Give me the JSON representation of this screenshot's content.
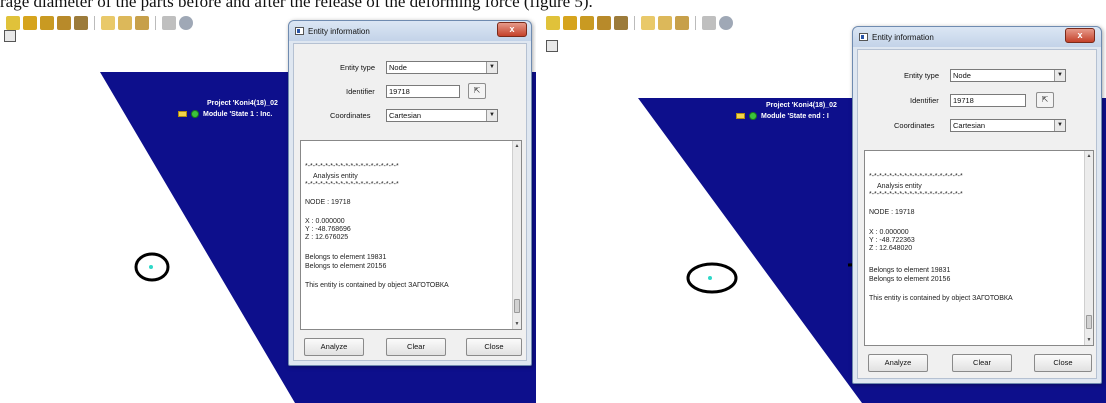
{
  "caption": "rage diameter of the parts before and after the release of the deforming force (figure 5).",
  "colors": {
    "model_blue": "#0d0f8c",
    "viewport_bg": "#ffffff",
    "dialog_bg": "#dfe7f1",
    "close_red": "#c4412a"
  },
  "toolbar_icons": [
    "axes-icon",
    "select-icon",
    "grid-icon",
    "box-icon",
    "paint-icon",
    "arc-icon",
    "probe-icon",
    "node-icon",
    "undo-icon",
    "info-icon"
  ],
  "panels": [
    {
      "project_label": "Project 'Koni4(18)_02",
      "module_label": "Module 'State 1 : Inc.",
      "dialog": {
        "title": "Entity information",
        "close_glyph": "x",
        "entity_type_label": "Entity type",
        "entity_type_value": "Node",
        "identifier_label": "Identifier",
        "identifier_value": "19718",
        "coordinates_label": "Coordinates",
        "coordinates_value": "Cartesian",
        "info_lines": [
          "*-*-*-*-*-*-*-*-*-*-*-*-*-*-*-*-*-*-*",
          "Analysis entity",
          "*-*-*-*-*-*-*-*-*-*-*-*-*-*-*-*-*-*-*",
          "NODE    : 19718",
          "X        : 0.000000",
          "Y        : -48.768696",
          "Z        : 12.676025",
          "Belongs to element 19831",
          "Belongs to element 20156",
          "This entity is contained by object ЗАГОТОВКА"
        ],
        "analyze_label": "Analyze",
        "clear_label": "Clear",
        "close_label": "Close"
      }
    },
    {
      "project_label": "Project 'Koni4(18)_02",
      "module_label": "Module 'State end : I",
      "dialog": {
        "title": "Entity information",
        "close_glyph": "x",
        "entity_type_label": "Entity type",
        "entity_type_value": "Node",
        "identifier_label": "Identifier",
        "identifier_value": "19718",
        "coordinates_label": "Coordinates",
        "coordinates_value": "Cartesian",
        "info_lines": [
          "*-*-*-*-*-*-*-*-*-*-*-*-*-*-*-*-*-*-*",
          "Analysis entity",
          "*-*-*-*-*-*-*-*-*-*-*-*-*-*-*-*-*-*-*",
          "NODE    : 19718",
          "X        : 0.000000",
          "Y        : -48.722363",
          "Z        : 12.648020",
          "Belongs to element 19831",
          "Belongs to element 20156",
          "This entity is contained by object ЗАГОТОВКА"
        ],
        "analyze_label": "Analyze",
        "clear_label": "Clear",
        "close_label": "Close"
      }
    }
  ]
}
